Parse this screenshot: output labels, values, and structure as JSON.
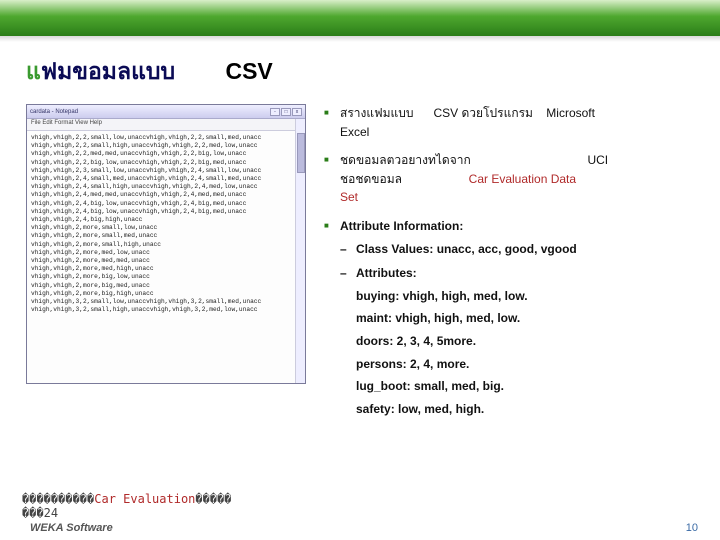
{
  "title": {
    "accent": "แ",
    "rest": "ฟมขอมลแบบ",
    "csv": "CSV"
  },
  "notepad": {
    "title": "cardata - Notepad",
    "menu": "File   Edit   Format   View   Help",
    "lines": "vhigh,vhigh,2,2,small,low,unaccvhigh,vhigh,2,2,small,med,unacc\nvhigh,vhigh,2,2,small,high,unaccvhigh,vhigh,2,2,med,low,unacc\nvhigh,vhigh,2,2,med,med,unaccvhigh,vhigh,2,2,big,low,unacc\nvhigh,vhigh,2,2,big,low,unaccvhigh,vhigh,2,2,big,med,unacc\nvhigh,vhigh,2,3,small,low,unaccvhigh,vhigh,2,4,small,low,unacc\nvhigh,vhigh,2,4,small,med,unaccvhigh,vhigh,2,4,small,med,unacc\nvhigh,vhigh,2,4,small,high,unaccvhigh,vhigh,2,4,med,low,unacc\nvhigh,vhigh,2,4,med,med,unaccvhigh,vhigh,2,4,med,med,unacc\nvhigh,vhigh,2,4,big,low,unaccvhigh,vhigh,2,4,big,med,unacc\nvhigh,vhigh,2,4,big,low,unaccvhigh,vhigh,2,4,big,med,unacc\nvhigh,vhigh,2,4,big,high,unacc\nvhigh,vhigh,2,more,small,low,unacc\nvhigh,vhigh,2,more,small,med,unacc\nvhigh,vhigh,2,more,small,high,unacc\nvhigh,vhigh,2,more,med,low,unacc\nvhigh,vhigh,2,more,med,med,unacc\nvhigh,vhigh,2,more,med,high,unacc\nvhigh,vhigh,2,more,big,low,unacc\nvhigh,vhigh,2,more,big,med,unacc\nvhigh,vhigh,2,more,big,high,unacc\nvhigh,vhigh,3,2,small,low,unaccvhigh,vhigh,3,2,small,med,unacc\nvhigh,vhigh,3,2,small,high,unaccvhigh,vhigh,3,2,med,low,unacc"
  },
  "bullets": {
    "b1_pre": "สรางแฟมแบบ",
    "b1_mid": "CSV ดวยโปรแกรม",
    "b1_post": "Microsoft",
    "b1_line2": "Excel",
    "b2_pre": "ชดขอมลตวอยางทไดจาก",
    "b2_uci": "UCI",
    "b2_line2a": "ชอชดขอมล",
    "b2_line2b": "Car Evaluation Data",
    "b2_line3": "Set",
    "b3_title": "Attribute Information:",
    "b3_s1": "Class Values: unacc, acc, good, vgood",
    "b3_s2": "Attributes:",
    "attrs": {
      "buying": "buying: vhigh, high, med, low.",
      "maint": "maint: vhigh, high, med, low.",
      "doors": "doors: 2, 3, 4, 5more.",
      "persons": "persons: 2, 4, more.",
      "lug": "lug_boot: small, med, big.",
      "safety": "safety: low, med, high."
    }
  },
  "bottom": {
    "row1a": "����������",
    "row1_mid": "Car Evaluation",
    "row1b": "�����",
    "row2": "���24"
  },
  "footer": "WEKA Software",
  "page": "10"
}
